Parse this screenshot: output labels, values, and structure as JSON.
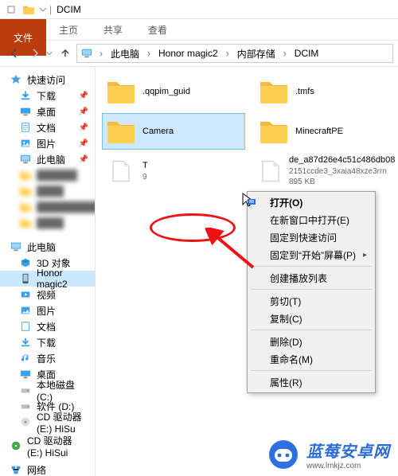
{
  "title_bar": {
    "title": "DCIM",
    "separator": "|"
  },
  "ribbon": {
    "file": "文件",
    "home": "主页",
    "share": "共享",
    "view": "查看"
  },
  "address": {
    "root": "此电脑",
    "seg1": "Honor magic2",
    "seg2": "内部存储",
    "seg3": "DCIM"
  },
  "sidebar": {
    "quick_access": "快速访问",
    "downloads": "下载",
    "desktop": "桌面",
    "documents": "文档",
    "pictures": "图片",
    "this_pc_q": "此电脑",
    "this_pc": "此电脑",
    "objects3d": "3D 对象",
    "honor": "Honor magic2",
    "videos": "视频",
    "pictures2": "图片",
    "documents2": "文档",
    "downloads2": "下载",
    "music": "音乐",
    "desktop2": "桌面",
    "local_c": "本地磁盘 (C:)",
    "soft_d": "软件 (D:)",
    "cd_e": "CD 驱动器 (E:) HiSu",
    "cd_e2": "CD 驱动器 (E:) HiSui",
    "network": "网络"
  },
  "files": [
    {
      "name": ".qqpim_guid"
    },
    {
      "name": ".tmfs"
    },
    {
      "name": "Camera"
    },
    {
      "name": "MinecraftPE"
    },
    {
      "name": "T",
      "meta": "9"
    },
    {
      "name": "de_a87d26e4c51c486db08",
      "meta1": "2151ccde3_3xaia48xze3rrn",
      "meta2": "895 KB"
    }
  ],
  "context_menu": {
    "open": "打开(O)",
    "open_new": "在新窗口中打开(E)",
    "pin_quick": "固定到快速访问",
    "pin_start": "固定到“开始”屏幕(P)",
    "playlist": "创建播放列表",
    "cut": "剪切(T)",
    "copy": "复制(C)",
    "delete": "删除(D)",
    "rename": "重命名(M)",
    "properties": "属性(R)"
  },
  "watermark": {
    "cn": "蓝莓安卓网",
    "url": "www.lmkjz.com"
  }
}
